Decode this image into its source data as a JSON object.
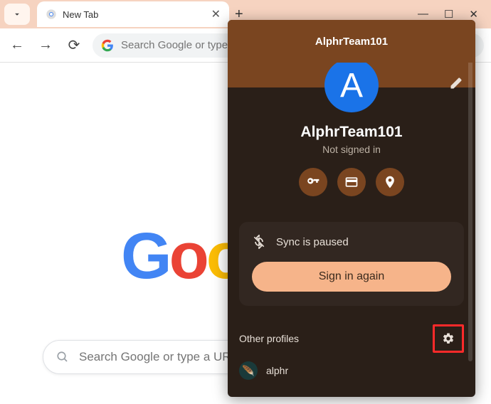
{
  "tab": {
    "title": "New Tab"
  },
  "omnibox": {
    "placeholder": "Search Google or type a URL"
  },
  "ntp_search": {
    "placeholder": "Search Google or type a URL"
  },
  "profile_panel": {
    "header_name": "AlphrTeam101",
    "avatar_letter": "A",
    "display_name": "AlphrTeam101",
    "signed_in_status": "Not signed in",
    "sync_status": "Sync is paused",
    "sign_in_button": "Sign in again",
    "other_profiles_title": "Other profiles",
    "other_profiles": [
      {
        "name": "alphr"
      }
    ]
  }
}
